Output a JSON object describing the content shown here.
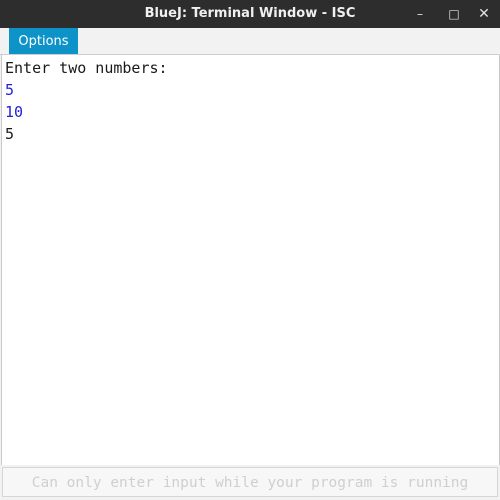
{
  "window": {
    "title": "BlueJ: Terminal Window - ISC",
    "controls": {
      "minimize_icon": "minimize-icon",
      "maximize_icon": "maximize-icon",
      "close_icon": "close-icon",
      "minimize_glyph": "–",
      "maximize_glyph": "□",
      "close_glyph": "✕"
    }
  },
  "menu": {
    "options_label": "Options"
  },
  "terminal": {
    "lines": [
      {
        "text": "Enter two numbers:",
        "color": "#1a1a1a",
        "kind": "output"
      },
      {
        "text": "5",
        "color": "#1f1fd6",
        "kind": "input"
      },
      {
        "text": "10",
        "color": "#1f1fd6",
        "kind": "input"
      },
      {
        "text": "5",
        "color": "#1a1a1a",
        "kind": "output"
      }
    ]
  },
  "input": {
    "placeholder": "Can only enter input while your program is running"
  },
  "colors": {
    "accent": "#0e93c8",
    "user_input": "#1f1fd6",
    "output": "#1a1a1a",
    "titlebar": "#2d2d2d"
  }
}
